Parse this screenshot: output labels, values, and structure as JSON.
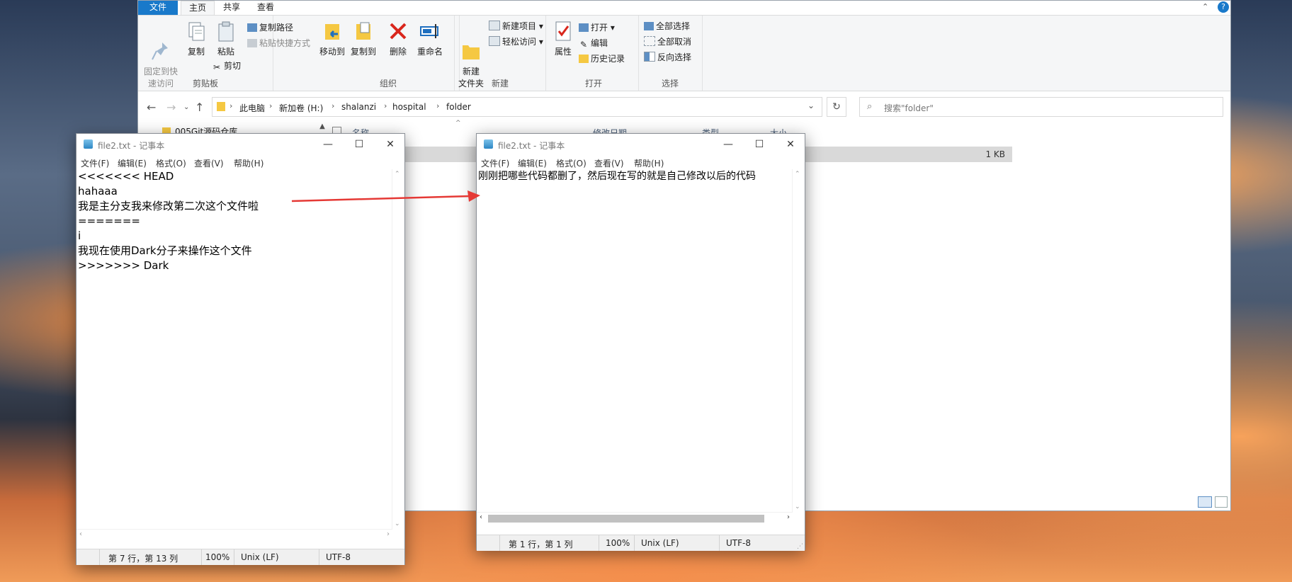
{
  "explorer": {
    "tabs": [
      "文件",
      "主页",
      "共享",
      "查看"
    ],
    "clipboard": {
      "pin_label": "固定到快\n速访问",
      "copy_label": "复制",
      "paste_label": "粘贴",
      "copy_path": "复制路径",
      "paste_shortcut": "粘贴快捷方式",
      "cut": "剪切",
      "group_label": "剪贴板"
    },
    "organize": {
      "move_to": "移动到",
      "copy_to": "复制到",
      "delete": "删除",
      "rename": "重命名",
      "group_label": "组织"
    },
    "new": {
      "new_folder": "新建\n文件夹",
      "new_item": "新建项目",
      "easy_access": "轻松访问",
      "group_label": "新建"
    },
    "open": {
      "properties": "属性",
      "open": "打开",
      "edit": "编辑",
      "history": "历史记录",
      "group_label": "打开"
    },
    "select": {
      "select_all": "全部选择",
      "select_none": "全部取消",
      "invert": "反向选择",
      "group_label": "选择"
    },
    "breadcrumbs": [
      "此电脑",
      "新加卷 (H:)",
      "shalanzi",
      "hospital",
      "folder"
    ],
    "search_placeholder": "搜索\"folder\"",
    "nav_item": "005Git源码仓库",
    "columns": [
      "名称",
      "修改日期",
      "类型",
      "大小"
    ],
    "file_size": "1 KB"
  },
  "notepad_left": {
    "title": "file2.txt - 记事本",
    "menu": [
      "文件(F)",
      "编辑(E)",
      "格式(O)",
      "查看(V)",
      "帮助(H)"
    ],
    "content": "<<<<<<< HEAD\nhahaaa\n我是主分支我来修改第二次这个文件啦\n=======\ni\n我现在使用Dark分子来操作这个文件\n>>>>>>> Dark",
    "status": {
      "position": "第 7 行，第 13 列",
      "zoom": "100%",
      "eol": "Unix (LF)",
      "encoding": "UTF-8"
    }
  },
  "notepad_right": {
    "title": "file2.txt - 记事本",
    "menu": [
      "文件(F)",
      "编辑(E)",
      "格式(O)",
      "查看(V)",
      "帮助(H)"
    ],
    "content": "刚刚把哪些代码都删了，然后现在写的就是自己修改以后的代码",
    "status": {
      "position": "第 1 行，第 1 列",
      "zoom": "100%",
      "eol": "Unix (LF)",
      "encoding": "UTF-8"
    }
  },
  "colors": {
    "accent": "#1979ca",
    "arrow": "#e53935"
  }
}
